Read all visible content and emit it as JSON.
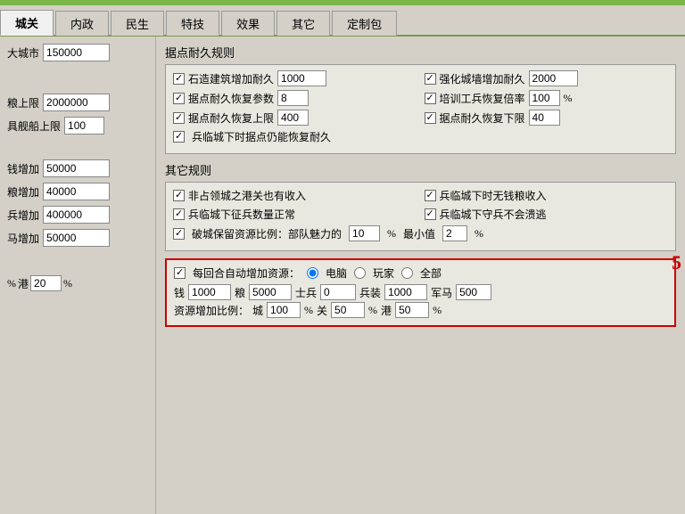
{
  "topbar": {
    "color": "#7ab648"
  },
  "tabs": [
    {
      "label": "城关",
      "active": true
    },
    {
      "label": "内政",
      "active": false
    },
    {
      "label": "民生",
      "active": false
    },
    {
      "label": "特技",
      "active": false
    },
    {
      "label": "效果",
      "active": false
    },
    {
      "label": "其它",
      "active": false
    },
    {
      "label": "定制包",
      "active": false
    }
  ],
  "sidebar": {
    "rows": [
      {
        "label": "大城市",
        "value": "150000"
      },
      {
        "label": "粮上限",
        "value": "2000000"
      },
      {
        "label": "具舰船上限",
        "value": "100"
      },
      {
        "label": "钱增加",
        "value": "50000"
      },
      {
        "label": "粮增加",
        "value": "40000"
      },
      {
        "label": "兵增加",
        "value": "400000"
      },
      {
        "label": "马增加",
        "value": "50000"
      }
    ],
    "bottom_row": {
      "prefix": "%",
      "port_label": "港",
      "port_value": "20",
      "suffix": "%"
    }
  },
  "durability_section": {
    "title": "据点耐久规则",
    "rules": [
      {
        "col1": {
          "checked": true,
          "label": "石造建筑增加耐久",
          "value": "1000"
        },
        "col2": {
          "checked": true,
          "label": "强化城墙增加耐久",
          "value": "2000"
        }
      },
      {
        "col1": {
          "checked": true,
          "label": "据点耐久恢复参数",
          "value": "8"
        },
        "col2": {
          "checked": true,
          "label": "培训工兵恢复倍率",
          "value": "100",
          "unit": "%"
        }
      },
      {
        "col1": {
          "checked": true,
          "label": "据点耐久恢复上限",
          "value": "400"
        },
        "col2": {
          "checked": true,
          "label": "据点耐久恢复下限",
          "value": "40"
        }
      },
      {
        "col1": {
          "checked": true,
          "label": "兵临城下时据点仍能恢复耐久"
        },
        "col2": null
      }
    ]
  },
  "other_section": {
    "title": "其它规则",
    "rules": [
      {
        "col1": {
          "checked": true,
          "label": "非占领城之港关也有收入"
        },
        "col2": {
          "checked": true,
          "label": "兵临城下时无钱粮收入"
        }
      },
      {
        "col1": {
          "checked": true,
          "label": "兵临城下征兵数量正常"
        },
        "col2": {
          "checked": true,
          "label": "兵临城下守兵不会溃逃"
        }
      },
      {
        "col1": {
          "checked": true,
          "label": "破城保留资源比例：部队魅力的",
          "value1": "10",
          "unit1": "%",
          "label2": "最小值",
          "value2": "2",
          "unit2": "%"
        }
      }
    ]
  },
  "highlight_section": {
    "number": "5",
    "auto_resource": {
      "checked": true,
      "label": "每回合自动增加资源：",
      "options": [
        {
          "label": "电脑",
          "checked": true
        },
        {
          "label": "玩家",
          "checked": false
        },
        {
          "label": "全部",
          "checked": false
        }
      ]
    },
    "resources": {
      "money_label": "钱",
      "money_value": "1000",
      "grain_label": "粮",
      "grain_value": "5000",
      "soldier_label": "士兵",
      "soldier_value": "0",
      "equipment_label": "兵装",
      "equipment_value": "1000",
      "horse_label": "军马",
      "horse_value": "500"
    },
    "ratio": {
      "label": "资源增加比例：",
      "city_label": "城",
      "city_value": "100",
      "city_unit": "%",
      "gate_label": "关",
      "gate_value": "50",
      "gate_unit": "%",
      "port_label": "港",
      "port_value": "50",
      "port_unit": "%"
    }
  }
}
